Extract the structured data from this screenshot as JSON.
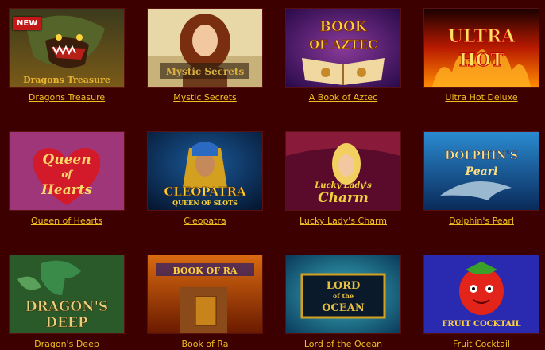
{
  "badge": {
    "new_label": "NEW"
  },
  "games": [
    {
      "name": "Dragons Treasure",
      "art_text": "Dragons Treasure"
    },
    {
      "name": "Mystic Secrets",
      "art_text": "Mystic Secrets"
    },
    {
      "name": "A Book of Aztec",
      "art_text": [
        "BOOK",
        "OF AZTEC"
      ]
    },
    {
      "name": "Ultra Hot Deluxe",
      "art_text": [
        "ULTRA",
        "HOT"
      ]
    },
    {
      "name": "Queen of Hearts",
      "art_text": [
        "Queen",
        "of",
        "Hearts"
      ]
    },
    {
      "name": "Cleopatra",
      "art_text": [
        "CLEOPATRA",
        "QUEEN OF SLOTS"
      ]
    },
    {
      "name": "Lucky Lady's Charm",
      "art_text": [
        "Lucky Lady's",
        "Charm"
      ]
    },
    {
      "name": "Dolphin's Pearl",
      "art_text": [
        "DOLPHIN'S",
        "Pearl"
      ]
    },
    {
      "name": "Dragon's Deep",
      "art_text": [
        "DRAGON'S",
        "DEEP"
      ]
    },
    {
      "name": "Book of Ra",
      "art_text": "BOOK OF RA"
    },
    {
      "name": "Lord of the Ocean",
      "art_text": [
        "LORD",
        "of the",
        "OCEAN"
      ]
    },
    {
      "name": "Fruit Cocktail",
      "art_text": "FRUIT COCKTAIL"
    }
  ],
  "colors": {
    "background": "#3c0000",
    "caption": "#f0c020",
    "badge": "#c21818"
  }
}
